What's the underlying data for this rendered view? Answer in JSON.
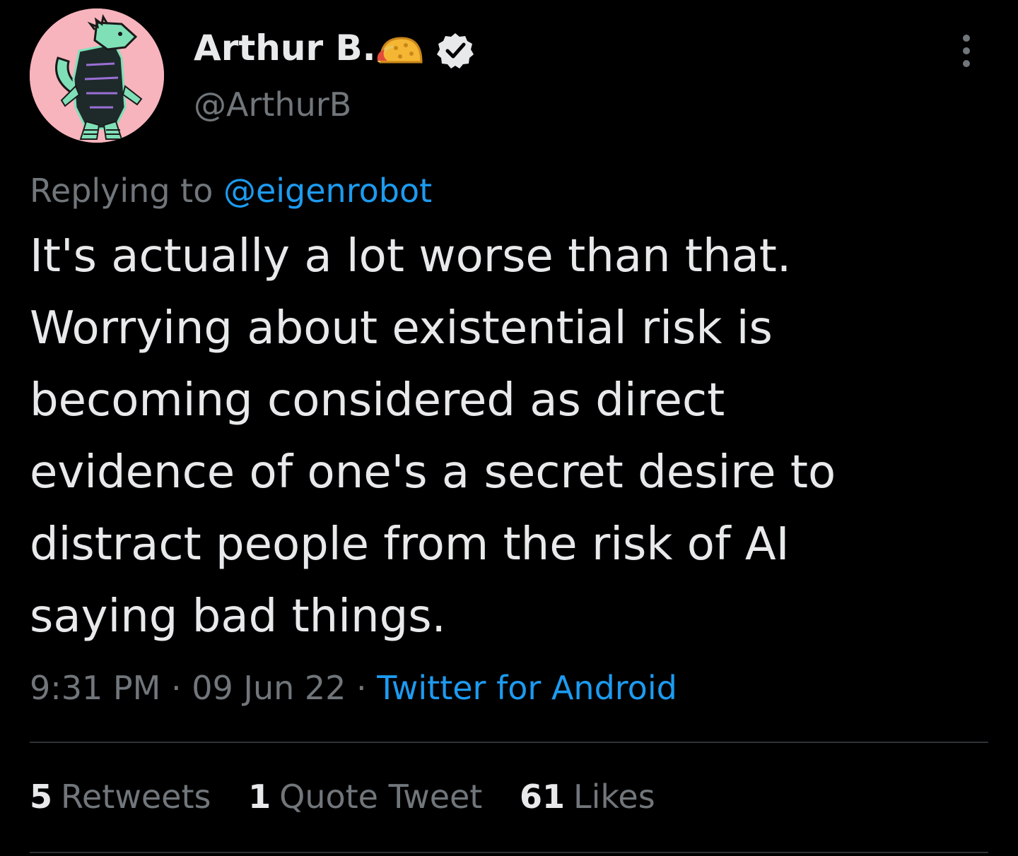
{
  "author": {
    "display_name": "Arthur B.",
    "handle": "@ArthurB",
    "badges": [
      "taco-emoji",
      "verified-badge-icon"
    ]
  },
  "reply": {
    "prefix": "Replying to",
    "mention": "@eigenrobot"
  },
  "tweet": {
    "text": "It's actually a lot worse than that.\nWorrying about existential risk is\nbecoming considered as direct\nevidence of one's a secret desire to\ndistract people from the risk of AI\nsaying bad things."
  },
  "meta": {
    "time": "9:31 PM",
    "separator": "·",
    "date": "09 Jun 22",
    "source": "Twitter for Android"
  },
  "stats": {
    "retweets_count": "5",
    "retweets_label": "Retweets",
    "quotes_count": "1",
    "quotes_label": "Quote Tweet",
    "likes_count": "61",
    "likes_label": "Likes"
  },
  "colors": {
    "background": "#000000",
    "text_primary": "#e7e9ea",
    "text_secondary": "#71767b",
    "link": "#1d9bf0",
    "avatar_bg": "#f7b4bd"
  }
}
